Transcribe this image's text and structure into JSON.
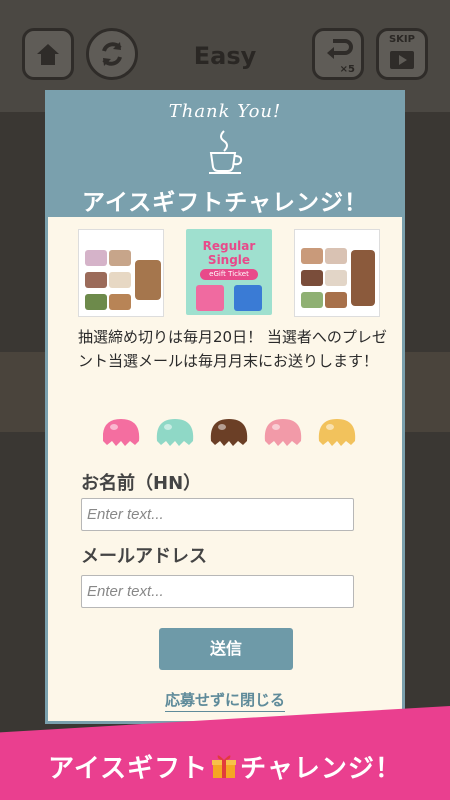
{
  "header": {
    "title": "Easy",
    "undo_count": "×5",
    "skip_label": "SKIP"
  },
  "modal": {
    "thank_you": "Thank You!",
    "title": "アイスギフトチャレンジ！",
    "gift_card": {
      "line1": "Regular",
      "line2": "Single",
      "line3": "eGift Ticket"
    },
    "description": "抽選締め切りは毎月20日！ 当選者へのプレゼント当選メールは毎月月末にお送りします！",
    "scoop_colors": [
      "#f46ea0",
      "#8fd8c6",
      "#6b3f26",
      "#f29aa8",
      "#f2c25c"
    ],
    "name_label": "お名前（HN）",
    "name_placeholder": "Enter text...",
    "email_label": "メールアドレス",
    "email_placeholder": "Enter text...",
    "submit_label": "送信",
    "close_label": "応募せずに閉じる"
  },
  "banner": {
    "text_left": "アイスギフト",
    "text_right": "チャレンジ！"
  },
  "colors": {
    "modal_accent": "#7aa0ad",
    "banner": "#ea3f8f",
    "submit": "#6e9aa8"
  }
}
